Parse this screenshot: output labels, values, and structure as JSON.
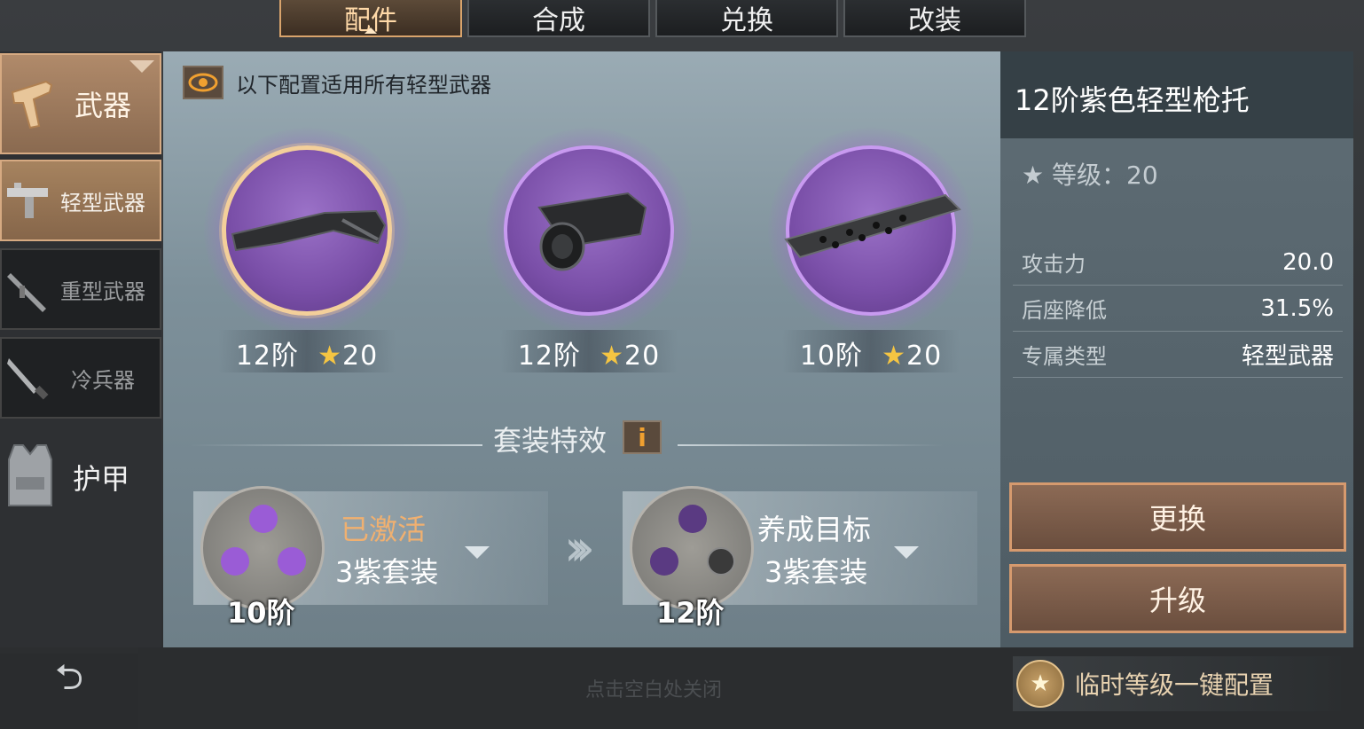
{
  "tabs": [
    {
      "label": "配件",
      "active": true
    },
    {
      "label": "合成",
      "active": false
    },
    {
      "label": "兑换",
      "active": false
    },
    {
      "label": "改装",
      "active": false
    }
  ],
  "sidebar": {
    "category": "武器",
    "items": [
      {
        "label": "轻型武器",
        "icon": "smg-icon",
        "active": true
      },
      {
        "label": "重型武器",
        "icon": "rocket-launcher-icon",
        "active": false
      },
      {
        "label": "冷兵器",
        "icon": "knife-icon",
        "active": false
      }
    ],
    "armor": "护甲"
  },
  "notice": "以下配置适用所有轻型武器",
  "slots": [
    {
      "tier": "12阶",
      "stars": "20",
      "item": "stock-icon",
      "selected": true
    },
    {
      "tier": "12阶",
      "stars": "20",
      "item": "scope-icon",
      "selected": false
    },
    {
      "tier": "10阶",
      "stars": "20",
      "item": "suppressor-icon",
      "selected": false
    }
  ],
  "set_effect": {
    "title": "套装特效",
    "info": "i",
    "current": {
      "status": "已激活",
      "name": "3紫套装",
      "tier": "10阶"
    },
    "target": {
      "status": "养成目标",
      "name": "3紫套装",
      "tier": "12阶"
    }
  },
  "detail": {
    "title": "12阶紫色轻型枪托",
    "level": "等级：20",
    "stats": [
      {
        "key": "攻击力",
        "value": "20.0"
      },
      {
        "key": "后座降低",
        "value": "31.5%"
      },
      {
        "key": "专属类型",
        "value": "轻型武器"
      }
    ],
    "replace": "更换",
    "upgrade": "升级"
  },
  "close_hint": "点击空白处关闭",
  "quick_config": "临时等级一键配置",
  "colors": {
    "purple": "#8a5cc0",
    "accent": "#d69a6e",
    "gold": "#f5c542"
  }
}
